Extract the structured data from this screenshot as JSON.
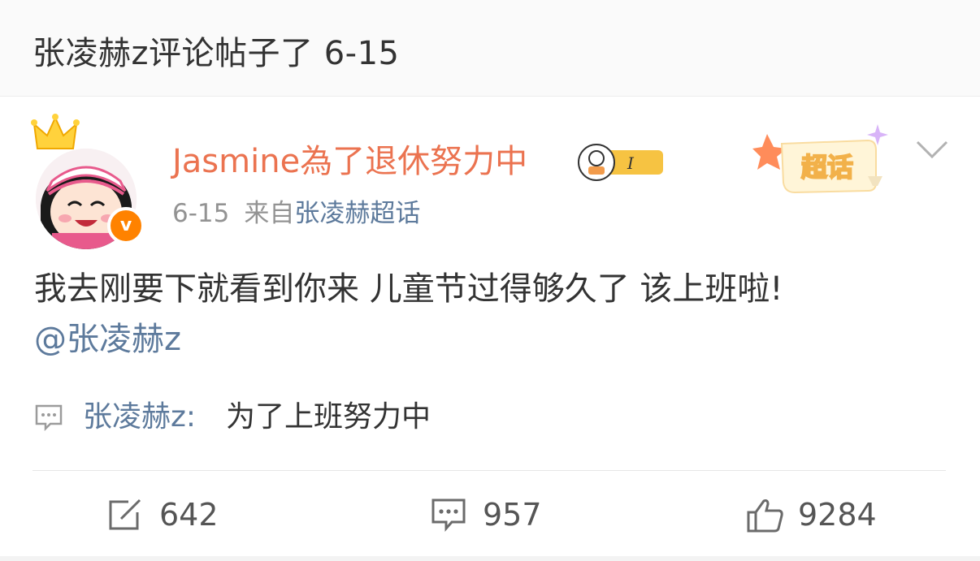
{
  "header": {
    "title": "张凌赫z评论帖子了 6-15"
  },
  "post": {
    "author": {
      "name": "Jasmine為了退休努力中",
      "verified_mark": "v",
      "badge_text": "I",
      "avatar_icon": "cartoon-girl-avatar",
      "crown_icon": "crown-icon"
    },
    "supertopic_label": "超话",
    "date": "6-15",
    "source_prefix": "来自",
    "source_link": "张凌赫超话",
    "body_line1": "我去刚要下就看到你来 儿童节过得够久了 该上班啦!",
    "body_mention": "@张凌赫z",
    "comment": {
      "author": "张凌赫z:",
      "text": "为了上班努力中"
    },
    "actions": {
      "repost_count": "642",
      "comment_count": "957",
      "like_count": "9284"
    }
  },
  "colors": {
    "username": "#eb7350",
    "link": "#5d7a9c",
    "text": "#333333",
    "meta": "#939393",
    "verified": "#ff8200"
  }
}
